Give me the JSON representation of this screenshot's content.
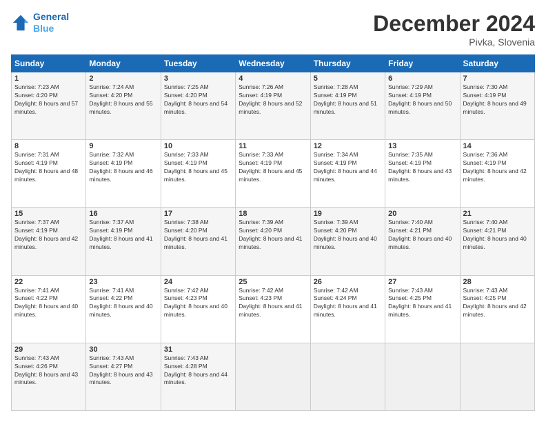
{
  "header": {
    "logo_line1": "General",
    "logo_line2": "Blue",
    "month": "December 2024",
    "location": "Pivka, Slovenia"
  },
  "weekdays": [
    "Sunday",
    "Monday",
    "Tuesday",
    "Wednesday",
    "Thursday",
    "Friday",
    "Saturday"
  ],
  "weeks": [
    [
      {
        "day": "1",
        "sunrise": "7:23 AM",
        "sunset": "4:20 PM",
        "daylight": "8 hours and 57 minutes."
      },
      {
        "day": "2",
        "sunrise": "7:24 AM",
        "sunset": "4:20 PM",
        "daylight": "8 hours and 55 minutes."
      },
      {
        "day": "3",
        "sunrise": "7:25 AM",
        "sunset": "4:20 PM",
        "daylight": "8 hours and 54 minutes."
      },
      {
        "day": "4",
        "sunrise": "7:26 AM",
        "sunset": "4:19 PM",
        "daylight": "8 hours and 52 minutes."
      },
      {
        "day": "5",
        "sunrise": "7:28 AM",
        "sunset": "4:19 PM",
        "daylight": "8 hours and 51 minutes."
      },
      {
        "day": "6",
        "sunrise": "7:29 AM",
        "sunset": "4:19 PM",
        "daylight": "8 hours and 50 minutes."
      },
      {
        "day": "7",
        "sunrise": "7:30 AM",
        "sunset": "4:19 PM",
        "daylight": "8 hours and 49 minutes."
      }
    ],
    [
      {
        "day": "8",
        "sunrise": "7:31 AM",
        "sunset": "4:19 PM",
        "daylight": "8 hours and 48 minutes."
      },
      {
        "day": "9",
        "sunrise": "7:32 AM",
        "sunset": "4:19 PM",
        "daylight": "8 hours and 46 minutes."
      },
      {
        "day": "10",
        "sunrise": "7:33 AM",
        "sunset": "4:19 PM",
        "daylight": "8 hours and 45 minutes."
      },
      {
        "day": "11",
        "sunrise": "7:33 AM",
        "sunset": "4:19 PM",
        "daylight": "8 hours and 45 minutes."
      },
      {
        "day": "12",
        "sunrise": "7:34 AM",
        "sunset": "4:19 PM",
        "daylight": "8 hours and 44 minutes."
      },
      {
        "day": "13",
        "sunrise": "7:35 AM",
        "sunset": "4:19 PM",
        "daylight": "8 hours and 43 minutes."
      },
      {
        "day": "14",
        "sunrise": "7:36 AM",
        "sunset": "4:19 PM",
        "daylight": "8 hours and 42 minutes."
      }
    ],
    [
      {
        "day": "15",
        "sunrise": "7:37 AM",
        "sunset": "4:19 PM",
        "daylight": "8 hours and 42 minutes."
      },
      {
        "day": "16",
        "sunrise": "7:37 AM",
        "sunset": "4:19 PM",
        "daylight": "8 hours and 41 minutes."
      },
      {
        "day": "17",
        "sunrise": "7:38 AM",
        "sunset": "4:20 PM",
        "daylight": "8 hours and 41 minutes."
      },
      {
        "day": "18",
        "sunrise": "7:39 AM",
        "sunset": "4:20 PM",
        "daylight": "8 hours and 41 minutes."
      },
      {
        "day": "19",
        "sunrise": "7:39 AM",
        "sunset": "4:20 PM",
        "daylight": "8 hours and 40 minutes."
      },
      {
        "day": "20",
        "sunrise": "7:40 AM",
        "sunset": "4:21 PM",
        "daylight": "8 hours and 40 minutes."
      },
      {
        "day": "21",
        "sunrise": "7:40 AM",
        "sunset": "4:21 PM",
        "daylight": "8 hours and 40 minutes."
      }
    ],
    [
      {
        "day": "22",
        "sunrise": "7:41 AM",
        "sunset": "4:22 PM",
        "daylight": "8 hours and 40 minutes."
      },
      {
        "day": "23",
        "sunrise": "7:41 AM",
        "sunset": "4:22 PM",
        "daylight": "8 hours and 40 minutes."
      },
      {
        "day": "24",
        "sunrise": "7:42 AM",
        "sunset": "4:23 PM",
        "daylight": "8 hours and 40 minutes."
      },
      {
        "day": "25",
        "sunrise": "7:42 AM",
        "sunset": "4:23 PM",
        "daylight": "8 hours and 41 minutes."
      },
      {
        "day": "26",
        "sunrise": "7:42 AM",
        "sunset": "4:24 PM",
        "daylight": "8 hours and 41 minutes."
      },
      {
        "day": "27",
        "sunrise": "7:43 AM",
        "sunset": "4:25 PM",
        "daylight": "8 hours and 41 minutes."
      },
      {
        "day": "28",
        "sunrise": "7:43 AM",
        "sunset": "4:25 PM",
        "daylight": "8 hours and 42 minutes."
      }
    ],
    [
      {
        "day": "29",
        "sunrise": "7:43 AM",
        "sunset": "4:26 PM",
        "daylight": "8 hours and 43 minutes."
      },
      {
        "day": "30",
        "sunrise": "7:43 AM",
        "sunset": "4:27 PM",
        "daylight": "8 hours and 43 minutes."
      },
      {
        "day": "31",
        "sunrise": "7:43 AM",
        "sunset": "4:28 PM",
        "daylight": "8 hours and 44 minutes."
      },
      null,
      null,
      null,
      null
    ]
  ],
  "labels": {
    "sunrise": "Sunrise:",
    "sunset": "Sunset:",
    "daylight": "Daylight:"
  }
}
